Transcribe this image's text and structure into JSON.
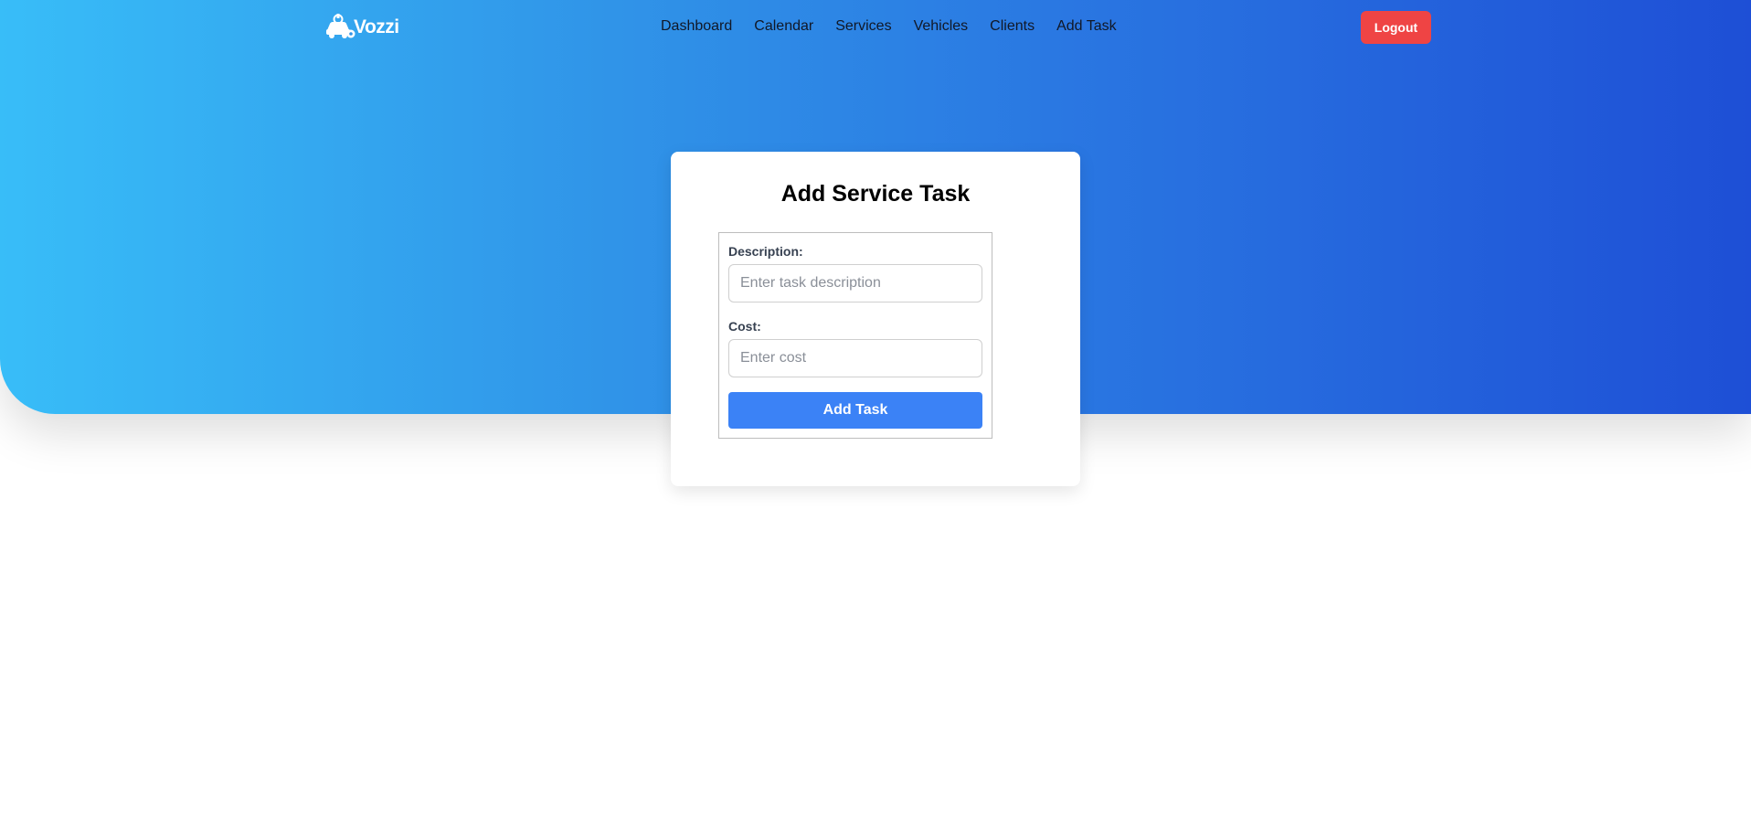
{
  "brand": {
    "name": "Vozzi",
    "logo_icon": "car-wrench-icon"
  },
  "nav": {
    "links": [
      {
        "label": "Dashboard"
      },
      {
        "label": "Calendar"
      },
      {
        "label": "Services"
      },
      {
        "label": "Vehicles"
      },
      {
        "label": "Clients"
      },
      {
        "label": "Add Task"
      }
    ],
    "logout_label": "Logout"
  },
  "form": {
    "title": "Add Service Task",
    "description": {
      "label": "Description:",
      "placeholder": "Enter task description",
      "value": ""
    },
    "cost": {
      "label": "Cost:",
      "placeholder": "Enter cost",
      "value": ""
    },
    "submit_label": "Add Task"
  },
  "colors": {
    "hero_gradient_start": "#38bdf8",
    "hero_gradient_end": "#1e4fd6",
    "logout": "#ef4444",
    "primary": "#3b82f6"
  }
}
